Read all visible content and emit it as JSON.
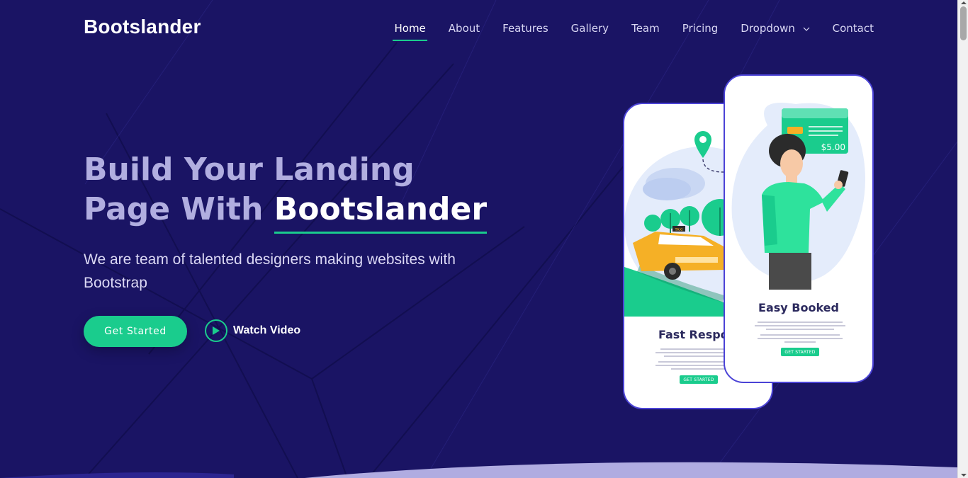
{
  "brand": {
    "logo": "Bootslander"
  },
  "nav": {
    "items": [
      {
        "label": "Home",
        "active": true
      },
      {
        "label": "About"
      },
      {
        "label": "Features"
      },
      {
        "label": "Gallery"
      },
      {
        "label": "Team"
      },
      {
        "label": "Pricing"
      },
      {
        "label": "Dropdown",
        "icon": "chevron-down-icon"
      },
      {
        "label": "Contact"
      }
    ]
  },
  "hero": {
    "title_line1": "Build Your Landing",
    "title_line2_prefix": "Page With",
    "title_brand": "Bootslander",
    "subtitle": "We are team of talented designers making websites with Bootstrap",
    "get_started": "Get Started",
    "watch_video": "Watch Video"
  },
  "phones": {
    "left": {
      "title": "Fast Respor",
      "button": "GET STARTED",
      "taxi_sign": "TAXI"
    },
    "right": {
      "title": "Easy Booked",
      "button": "GET STARTED",
      "price": "$5.00"
    }
  },
  "colors": {
    "background": "#1a1464",
    "accent": "#1acc8d",
    "phone_border": "#4b43d6"
  }
}
